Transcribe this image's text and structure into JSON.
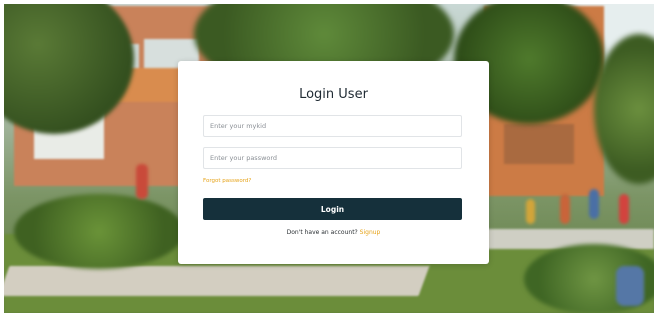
{
  "login_card": {
    "title": "Login User",
    "username_placeholder": "Enter your mykid",
    "password_placeholder": "Enter your password",
    "forgot_password": "Forgot password?",
    "login_button": "Login",
    "signup_prompt": "Don't have an account?",
    "signup_link": "Signup"
  },
  "colors": {
    "accent": "#e6a319",
    "button_bg": "#15303b",
    "card_bg": "#ffffff"
  }
}
